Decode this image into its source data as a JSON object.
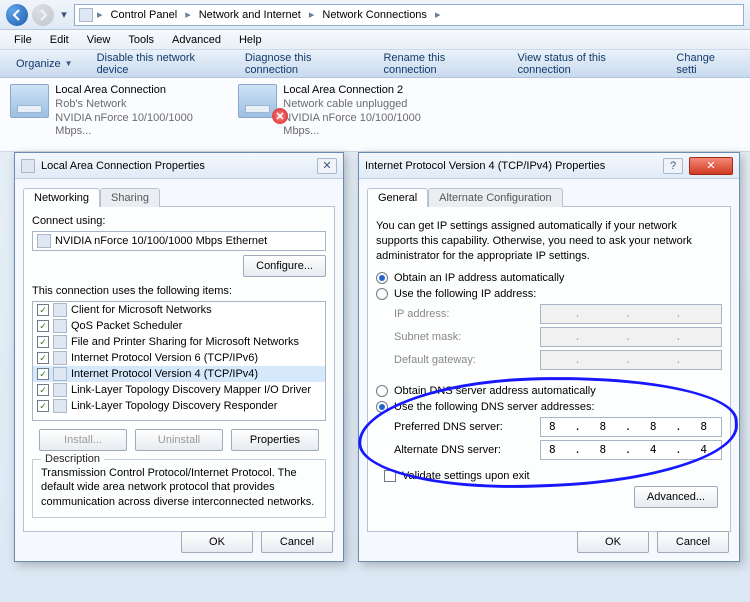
{
  "nav": {
    "crumbs": [
      "Control Panel",
      "Network and Internet",
      "Network Connections"
    ]
  },
  "menu": {
    "items": [
      "File",
      "Edit",
      "View",
      "Tools",
      "Advanced",
      "Help"
    ]
  },
  "toolbar": {
    "organize": "Organize",
    "disable": "Disable this network device",
    "diagnose": "Diagnose this connection",
    "rename": "Rename this connection",
    "status": "View status of this connection",
    "change": "Change setti"
  },
  "connections": [
    {
      "name": "Local Area Connection",
      "line2": "Rob's Network",
      "line3": "NVIDIA nForce 10/100/1000 Mbps..."
    },
    {
      "name": "Local Area Connection 2",
      "line2": "Network cable unplugged",
      "line3": "NVIDIA nForce 10/100/1000 Mbps..."
    }
  ],
  "dlg_left": {
    "title": "Local Area Connection Properties",
    "tabs": {
      "networking": "Networking",
      "sharing": "Sharing"
    },
    "connect_using_label": "Connect using:",
    "adapter": "NVIDIA nForce 10/100/1000 Mbps Ethernet",
    "configure": "Configure...",
    "items_label": "This connection uses the following items:",
    "items": [
      "Client for Microsoft Networks",
      "QoS Packet Scheduler",
      "File and Printer Sharing for Microsoft Networks",
      "Internet Protocol Version 6 (TCP/IPv6)",
      "Internet Protocol Version 4 (TCP/IPv4)",
      "Link-Layer Topology Discovery Mapper I/O Driver",
      "Link-Layer Topology Discovery Responder"
    ],
    "install": "Install...",
    "uninstall": "Uninstall",
    "properties": "Properties",
    "desc_title": "Description",
    "desc": "Transmission Control Protocol/Internet Protocol. The default wide area network protocol that provides communication across diverse interconnected networks.",
    "ok": "OK",
    "cancel": "Cancel"
  },
  "dlg_right": {
    "title": "Internet Protocol Version 4 (TCP/IPv4) Properties",
    "tabs": {
      "general": "General",
      "alt": "Alternate Configuration"
    },
    "intro": "You can get IP settings assigned automatically if your network supports this capability. Otherwise, you need to ask your network administrator for the appropriate IP settings.",
    "r_ip_auto": "Obtain an IP address automatically",
    "r_ip_manual": "Use the following IP address:",
    "ip_addr_label": "IP address:",
    "subnet_label": "Subnet mask:",
    "gateway_label": "Default gateway:",
    "r_dns_auto": "Obtain DNS server address automatically",
    "r_dns_manual": "Use the following DNS server addresses:",
    "pref_dns_label": "Preferred DNS server:",
    "alt_dns_label": "Alternate DNS server:",
    "pref_dns": "8 . 8 . 8 . 8",
    "alt_dns": "8 . 8 . 4 . 4",
    "validate": "Validate settings upon exit",
    "advanced": "Advanced...",
    "ok": "OK",
    "cancel": "Cancel"
  }
}
